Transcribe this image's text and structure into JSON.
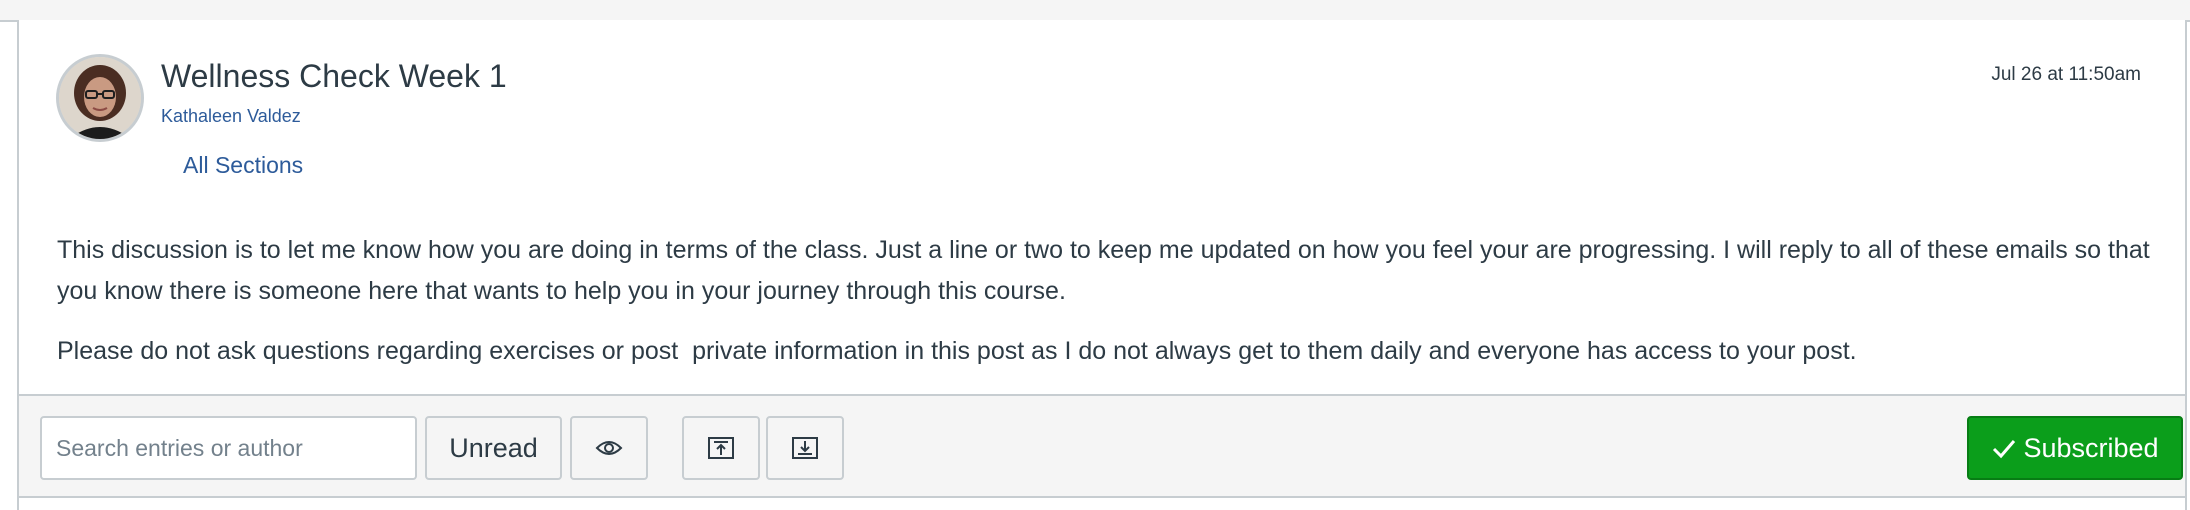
{
  "header": {
    "title": "Wellness Check Week 1",
    "author": "Kathaleen Valdez",
    "sections": "All Sections",
    "timestamp": "Jul 26 at 11:50am",
    "avatar_icon": "user-photo"
  },
  "body": {
    "paragraphs": [
      "This discussion is to let me know how you are doing in terms of the class. Just a line or two to keep me updated on how you feel your are progressing. I will reply to all of these emails so that you know there is someone here that wants to help you in your journey through this course.",
      "Please do not ask questions regarding exercises or post  private information in this post as I do not always get to them daily and everyone has access to your post."
    ]
  },
  "toolbar": {
    "search_placeholder": "Search entries or author",
    "search_value": "",
    "unread_label": "Unread",
    "eye_icon": "eye-icon",
    "collapse_icon": "collapse-up-icon",
    "expand_icon": "expand-down-icon",
    "subscribed_label": "Subscribed",
    "check_icon": "check-icon"
  },
  "colors": {
    "link": "#2d5b9a",
    "subscribed_bg": "#0b9e1b",
    "text": "#2d3b45",
    "border": "#c7cdd1",
    "toolbar_bg": "#f5f5f5"
  }
}
